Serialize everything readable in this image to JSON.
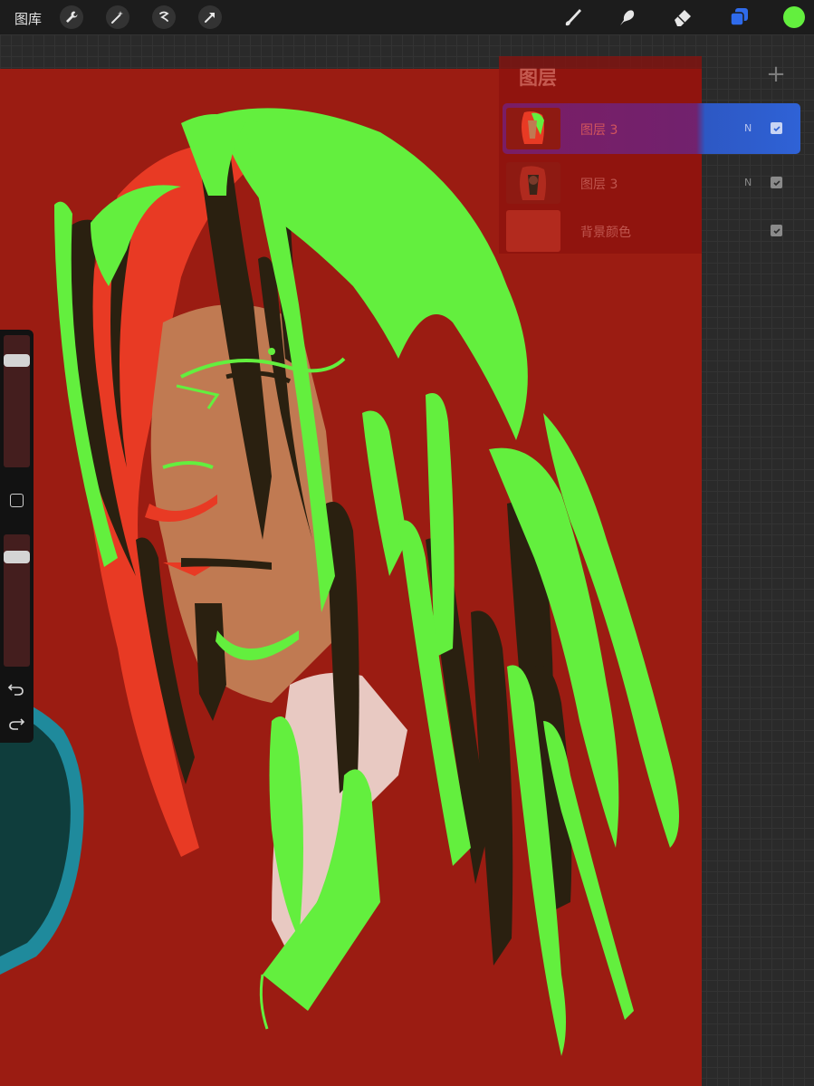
{
  "topbar": {
    "gallery_label": "图库",
    "left_tools": [
      "wrench-icon",
      "magic-wand-icon",
      "selection-icon",
      "transform-icon"
    ],
    "right_tools": [
      "brush-icon",
      "smudge-icon",
      "eraser-icon",
      "layers-icon"
    ],
    "current_color": "#63ef3e",
    "layers_accent": "#2f6bec"
  },
  "layers_panel": {
    "title": "图层",
    "add_label": "+",
    "layers": [
      {
        "name": "图层 3",
        "blend_mode": "N",
        "visible": true,
        "selected": true
      },
      {
        "name": "图层 3",
        "blend_mode": "N",
        "visible": true,
        "selected": false
      },
      {
        "name": "背景颜色",
        "blend_mode": "",
        "visible": true,
        "selected": false
      }
    ]
  },
  "sidebar": {
    "brush_size": 0.84,
    "opacity": 0.14,
    "undo_icon": "undo-icon",
    "redo_icon": "redo-icon"
  },
  "canvas": {
    "background_color": "#9b1c12"
  }
}
